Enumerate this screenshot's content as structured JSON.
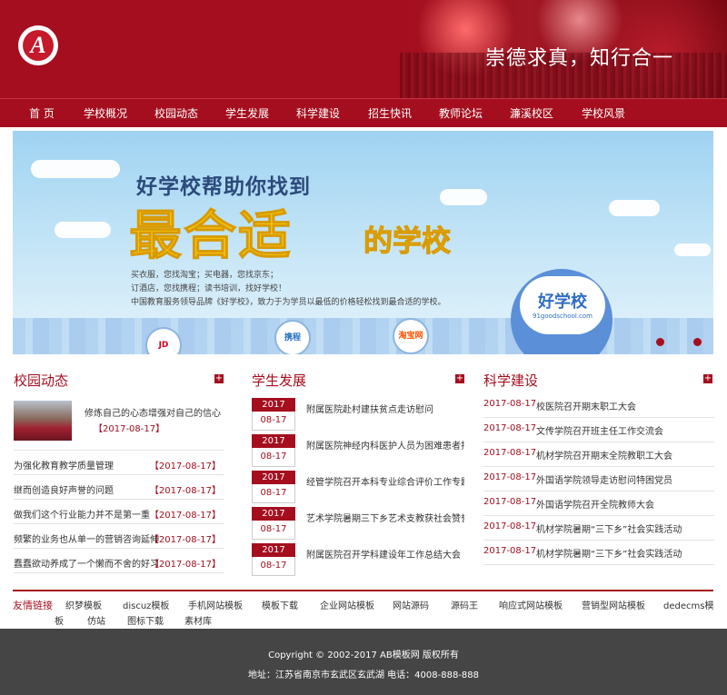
{
  "header": {
    "logo_letter": "A",
    "slogan": "崇德求真，知行合一"
  },
  "nav": {
    "items": [
      "首 页",
      "学校概况",
      "校园动态",
      "学生发展",
      "科学建设",
      "招生快讯",
      "教师论坛",
      "濂溪校区",
      "学校风景"
    ]
  },
  "banner": {
    "subtitle": "好学校帮助你找到",
    "headline_big": "最合适",
    "headline_small": "的学校",
    "lines": [
      "买衣服，您找淘宝；买电器，您找京东；",
      "订酒店，您找携程；读书培训，找好学校！",
      "中国教育服务领导品牌《好学校》，致力于为学员以最低的价格轻松找到最合适的学校。"
    ],
    "pin_title": "好学校",
    "pin_url": "91goodschool.com",
    "brand_jd": "JD",
    "brand_ctrip": "携程",
    "brand_taobao": "淘宝网"
  },
  "col1": {
    "title": "校园动态",
    "plus": "+",
    "featured": {
      "title": "修炼自己的心态增强对自己的信心",
      "date": "【2017-08-17】"
    },
    "rows": [
      {
        "title": "为强化教育教学质量管理",
        "date": "【2017-08-17】"
      },
      {
        "title": "继而创造良好声誉的问题",
        "date": "【2017-08-17】"
      },
      {
        "title": "做我们这个行业能力并不是第一重",
        "date": "【2017-08-17】"
      },
      {
        "title": "频繁的业务也从单一的营销咨询延伸到",
        "date": "【2017-08-17】"
      },
      {
        "title": "蠢蠢欲动养成了一个懒而不舍的好习惯",
        "date": "【2017-08-17】"
      }
    ]
  },
  "col2": {
    "title": "学生发展",
    "plus": "+",
    "rows": [
      {
        "year": "2017",
        "md": "08-17",
        "title": "附属医院赴村建扶贫点走访慰问"
      },
      {
        "year": "2017",
        "md": "08-17",
        "title": "附属医院神经内科医护人员为困难患者捐"
      },
      {
        "year": "2017",
        "md": "08-17",
        "title": "经管学院召开本科专业综合评价工作专题"
      },
      {
        "year": "2017",
        "md": "08-17",
        "title": "艺术学院暑期三下乡艺术支教获社会赞誉"
      },
      {
        "year": "2017",
        "md": "08-17",
        "title": "附属医院召开学科建设年工作总结大会"
      }
    ]
  },
  "col3": {
    "title": "科学建设",
    "plus": "+",
    "rows": [
      {
        "date": "2017-08-17",
        "title": "校医院召开期末职工大会"
      },
      {
        "date": "2017-08-17",
        "title": "文传学院召开班主任工作交流会"
      },
      {
        "date": "2017-08-17",
        "title": "机材学院召开期末全院教职工大会"
      },
      {
        "date": "2017-08-17",
        "title": "外国语学院领导走访慰问特困党员"
      },
      {
        "date": "2017-08-17",
        "title": "外国语学院召开全院教师大会"
      },
      {
        "date": "2017-08-17",
        "title": "机材学院暑期“三下乡”社会实践活动"
      },
      {
        "date": "2017-08-17",
        "title": "机材学院暑期“三下乡”社会实践活动"
      }
    ]
  },
  "links": {
    "label": "友情链接",
    "items": [
      "织梦模板",
      "discuz模板",
      "手机网站模板",
      "模板下载",
      "企业网站模板",
      "网站源码",
      "源码王",
      "响应式网站模板",
      "营销型网站模板",
      "dedecms模",
      "板",
      "仿站",
      "图标下载",
      "素材库"
    ]
  },
  "footer": {
    "copyright": "Copyright © 2002-2017 AB模板网 版权所有",
    "address": "地址：江苏省南京市玄武区玄武湖 电话：4008-888-888"
  }
}
